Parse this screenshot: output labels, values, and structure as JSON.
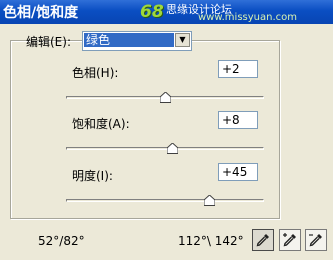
{
  "window": {
    "title": "色相/饱和度"
  },
  "watermark": {
    "logo": "68",
    "sub": "思缘设计论坛",
    "url": "www.missyuan.com"
  },
  "edit": {
    "label": "编辑(E):",
    "selected": "绿色"
  },
  "hue": {
    "label": "色相(H):",
    "value": "+2",
    "slider_fraction": 0.505
  },
  "saturation": {
    "label": "饱和度(A):",
    "value": "+8",
    "slider_fraction": 0.54
  },
  "lightness": {
    "label": "明度(I):",
    "value": "+45",
    "slider_fraction": 0.725
  },
  "range": {
    "left": "52°/82°",
    "right": "112°\\ 142°"
  },
  "tools": [
    "eyedropper-icon",
    "eyedropper-plus-icon",
    "eyedropper-minus-icon"
  ]
}
